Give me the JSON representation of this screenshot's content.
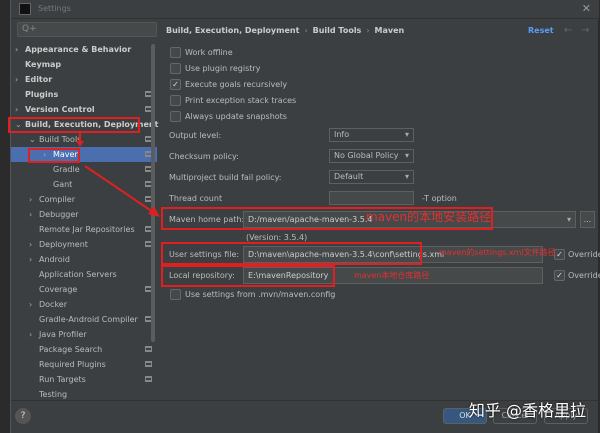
{
  "window": {
    "title": "Settings",
    "close": "✕"
  },
  "search": {
    "icon": "search-icon",
    "glyph": "Q+"
  },
  "sidebar": {
    "items": [
      {
        "label": "Appearance & Behavior",
        "level": 0,
        "arrow": "›",
        "bold": true
      },
      {
        "label": "Keymap",
        "level": 0,
        "bold": true
      },
      {
        "label": "Editor",
        "level": 0,
        "arrow": "›",
        "bold": true
      },
      {
        "label": "Plugins",
        "level": 0,
        "bold": true,
        "page": true
      },
      {
        "label": "Version Control",
        "level": 0,
        "arrow": "›",
        "bold": true,
        "page": true
      },
      {
        "label": "Build, Execution, Deployment",
        "level": 0,
        "arrow": "⌄",
        "bold": true
      },
      {
        "label": "Build Tools",
        "level": 1,
        "arrow": "⌄",
        "page": true
      },
      {
        "label": "Maven",
        "level": 2,
        "arrow": "›",
        "selected": true,
        "page": true
      },
      {
        "label": "Gradle",
        "level": 2,
        "page": true
      },
      {
        "label": "Gant",
        "level": 2,
        "page": true
      },
      {
        "label": "Compiler",
        "level": 1,
        "arrow": "›",
        "page": true
      },
      {
        "label": "Debugger",
        "level": 1,
        "arrow": "›"
      },
      {
        "label": "Remote Jar Repositories",
        "level": 1,
        "page": true
      },
      {
        "label": "Deployment",
        "level": 1,
        "arrow": "›",
        "page": true
      },
      {
        "label": "Android",
        "level": 1,
        "arrow": "›"
      },
      {
        "label": "Application Servers",
        "level": 1
      },
      {
        "label": "Coverage",
        "level": 1,
        "page": true
      },
      {
        "label": "Docker",
        "level": 1,
        "arrow": "›"
      },
      {
        "label": "Gradle-Android Compiler",
        "level": 1,
        "page": true
      },
      {
        "label": "Java Profiler",
        "level": 1,
        "arrow": "›"
      },
      {
        "label": "Package Search",
        "level": 1,
        "page": true
      },
      {
        "label": "Required Plugins",
        "level": 1,
        "page": true
      },
      {
        "label": "Run Targets",
        "level": 1,
        "page": true
      },
      {
        "label": "Testing",
        "level": 1
      }
    ]
  },
  "breadcrumb": [
    "Build, Execution, Deployment",
    "Build Tools",
    "Maven"
  ],
  "header": {
    "reset": "Reset",
    "back": "←",
    "forward": "→",
    "sep": "›",
    "menu": "≡"
  },
  "checkboxes": [
    {
      "label": "Work offline",
      "checked": false
    },
    {
      "label": "Use plugin registry",
      "checked": false
    },
    {
      "label": "Execute goals recursively",
      "checked": true
    },
    {
      "label": "Print exception stack traces",
      "checked": false
    },
    {
      "label": "Always update snapshots",
      "checked": false
    }
  ],
  "fields": {
    "output_level": {
      "label": "Output level:",
      "value": "Info"
    },
    "checksum": {
      "label": "Checksum policy:",
      "value": "No Global Policy"
    },
    "multiproject": {
      "label": "Multiproject build fail policy:",
      "value": "Default"
    },
    "thread": {
      "label": "Thread count",
      "value": "",
      "hint": "-T option"
    },
    "maven_home": {
      "label": "Maven home path:",
      "value": "D:/maven/apache-maven-3.5.4",
      "version": "(Version: 3.5.4)",
      "browse": "..."
    },
    "user_settings": {
      "label": "User settings file:",
      "value": "D:\\maven\\apache-maven-3.5.4\\conf\\settings.xml",
      "override": "Override",
      "override_checked": true
    },
    "local_repo": {
      "label": "Local repository:",
      "value": "E:\\mavenRepository",
      "override": "Override",
      "override_checked": true
    },
    "use_mvn_config": {
      "label": "Use settings from .mvn/maven.config",
      "checked": false
    }
  },
  "annotations": {
    "home": "maven的本地安装路径",
    "settings": "maven的settings.xml文件路径",
    "repo": "maven本地仓库路径",
    "color": "#e02020"
  },
  "buttons": {
    "ok": "OK",
    "cancel": "Cancel",
    "apply": "Apply",
    "help": "?"
  },
  "watermark": "知乎 @香格里拉",
  "colors": {
    "selection": "#4b6eaf",
    "link": "#589df6",
    "bg": "#3c3f41"
  }
}
